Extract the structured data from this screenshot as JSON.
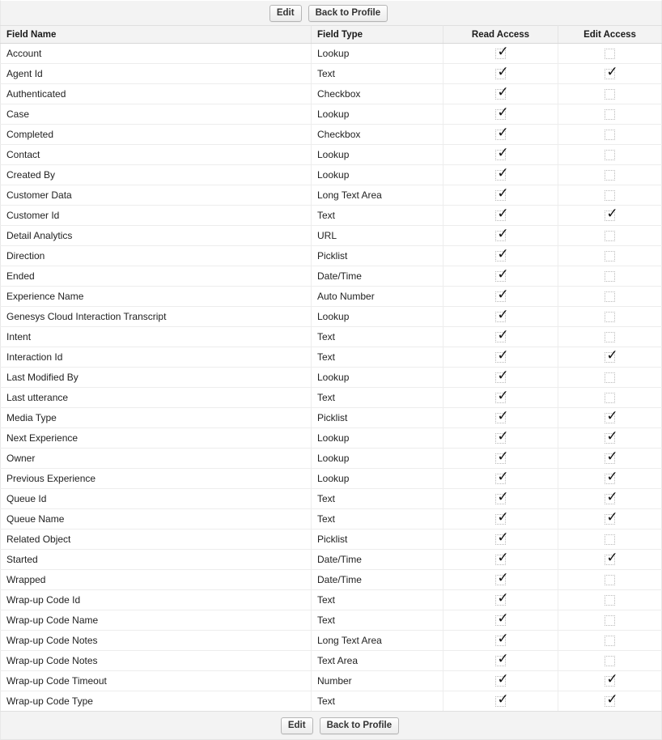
{
  "toolbar": {
    "edit_label": "Edit",
    "back_label": "Back to Profile"
  },
  "footer": {
    "edit_label": "Edit",
    "back_label": "Back to Profile"
  },
  "table": {
    "columns": [
      {
        "key": "field_name",
        "label": "Field Name"
      },
      {
        "key": "field_type",
        "label": "Field Type"
      },
      {
        "key": "read_access",
        "label": "Read Access"
      },
      {
        "key": "edit_access",
        "label": "Edit Access"
      }
    ],
    "checked_glyph": "✓",
    "rows": [
      {
        "field_name": "Account",
        "field_type": "Lookup",
        "read_access": true,
        "edit_access": false
      },
      {
        "field_name": "Agent Id",
        "field_type": "Text",
        "read_access": true,
        "edit_access": true
      },
      {
        "field_name": "Authenticated",
        "field_type": "Checkbox",
        "read_access": true,
        "edit_access": false
      },
      {
        "field_name": "Case",
        "field_type": "Lookup",
        "read_access": true,
        "edit_access": false
      },
      {
        "field_name": "Completed",
        "field_type": "Checkbox",
        "read_access": true,
        "edit_access": false
      },
      {
        "field_name": "Contact",
        "field_type": "Lookup",
        "read_access": true,
        "edit_access": false
      },
      {
        "field_name": "Created By",
        "field_type": "Lookup",
        "read_access": true,
        "edit_access": false
      },
      {
        "field_name": "Customer Data",
        "field_type": "Long Text Area",
        "read_access": true,
        "edit_access": false
      },
      {
        "field_name": "Customer Id",
        "field_type": "Text",
        "read_access": true,
        "edit_access": true
      },
      {
        "field_name": "Detail Analytics",
        "field_type": "URL",
        "read_access": true,
        "edit_access": false
      },
      {
        "field_name": "Direction",
        "field_type": "Picklist",
        "read_access": true,
        "edit_access": false
      },
      {
        "field_name": "Ended",
        "field_type": "Date/Time",
        "read_access": true,
        "edit_access": false
      },
      {
        "field_name": "Experience Name",
        "field_type": "Auto Number",
        "read_access": true,
        "edit_access": false
      },
      {
        "field_name": "Genesys Cloud Interaction Transcript",
        "field_type": "Lookup",
        "read_access": true,
        "edit_access": false
      },
      {
        "field_name": "Intent",
        "field_type": "Text",
        "read_access": true,
        "edit_access": false
      },
      {
        "field_name": "Interaction Id",
        "field_type": "Text",
        "read_access": true,
        "edit_access": true
      },
      {
        "field_name": "Last Modified By",
        "field_type": "Lookup",
        "read_access": true,
        "edit_access": false
      },
      {
        "field_name": "Last utterance",
        "field_type": "Text",
        "read_access": true,
        "edit_access": false
      },
      {
        "field_name": "Media Type",
        "field_type": "Picklist",
        "read_access": true,
        "edit_access": true
      },
      {
        "field_name": "Next Experience",
        "field_type": "Lookup",
        "read_access": true,
        "edit_access": true
      },
      {
        "field_name": "Owner",
        "field_type": "Lookup",
        "read_access": true,
        "edit_access": true
      },
      {
        "field_name": "Previous Experience",
        "field_type": "Lookup",
        "read_access": true,
        "edit_access": true
      },
      {
        "field_name": "Queue Id",
        "field_type": "Text",
        "read_access": true,
        "edit_access": true
      },
      {
        "field_name": "Queue Name",
        "field_type": "Text",
        "read_access": true,
        "edit_access": true
      },
      {
        "field_name": "Related Object",
        "field_type": "Picklist",
        "read_access": true,
        "edit_access": false
      },
      {
        "field_name": "Started",
        "field_type": "Date/Time",
        "read_access": true,
        "edit_access": true
      },
      {
        "field_name": "Wrapped",
        "field_type": "Date/Time",
        "read_access": true,
        "edit_access": false
      },
      {
        "field_name": "Wrap-up Code Id",
        "field_type": "Text",
        "read_access": true,
        "edit_access": false
      },
      {
        "field_name": "Wrap-up Code Name",
        "field_type": "Text",
        "read_access": true,
        "edit_access": false
      },
      {
        "field_name": "Wrap-up Code Notes",
        "field_type": "Long Text Area",
        "read_access": true,
        "edit_access": false
      },
      {
        "field_name": "Wrap-up Code Notes",
        "field_type": "Text Area",
        "read_access": true,
        "edit_access": false
      },
      {
        "field_name": "Wrap-up Code Timeout",
        "field_type": "Number",
        "read_access": true,
        "edit_access": true
      },
      {
        "field_name": "Wrap-up Code Type",
        "field_type": "Text",
        "read_access": true,
        "edit_access": true
      }
    ]
  }
}
